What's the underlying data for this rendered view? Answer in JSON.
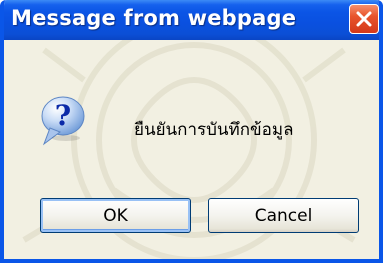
{
  "dialog": {
    "title": "Message from webpage",
    "message": "ยืนยันการบันทึกข้อมูล",
    "icon": "question-icon",
    "close_icon": "close-icon"
  },
  "buttons": {
    "ok_label": "OK",
    "cancel_label": "Cancel"
  },
  "colors": {
    "titlebar": "#0a50df",
    "frame": "#0a56e8",
    "client_background": "#f2f0e2",
    "close_button": "#e8542c",
    "button_border": "#003c74"
  }
}
